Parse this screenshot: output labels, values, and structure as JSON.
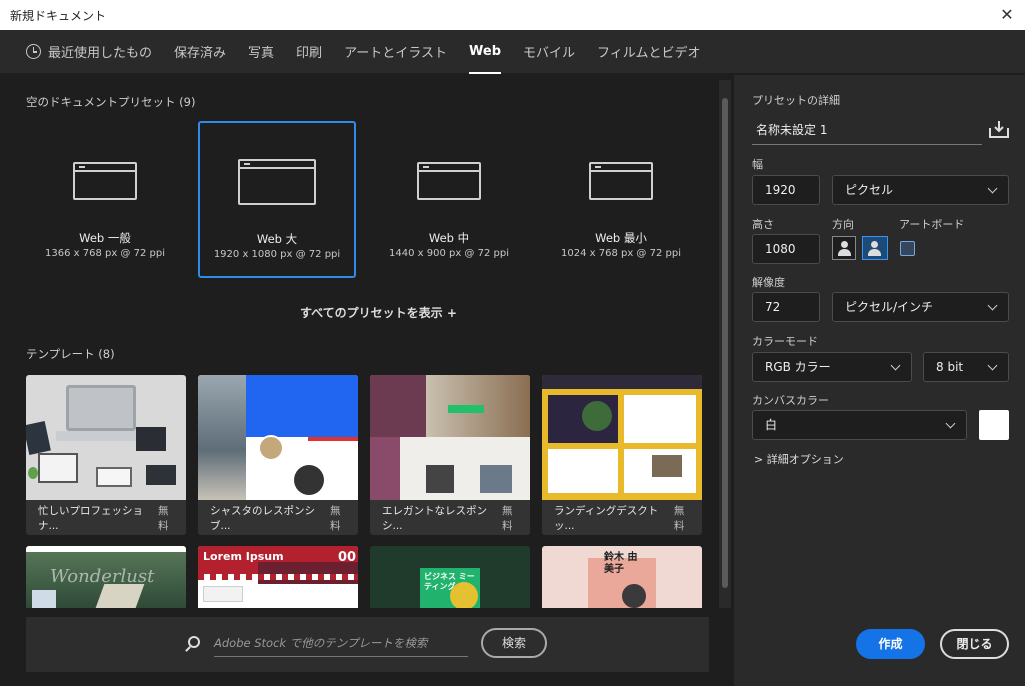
{
  "window": {
    "title": "新規ドキュメント"
  },
  "tabs": [
    {
      "label": "最近使用したもの"
    },
    {
      "label": "保存済み"
    },
    {
      "label": "写真"
    },
    {
      "label": "印刷"
    },
    {
      "label": "アートとイラスト"
    },
    {
      "label": "Web",
      "active": true
    },
    {
      "label": "モバイル"
    },
    {
      "label": "フィルムとビデオ"
    }
  ],
  "presets_section": {
    "label": "空のドキュメントプリセット (9)"
  },
  "presets": [
    {
      "name": "Web 一般",
      "size": "1366 x 768 px @ 72 ppi"
    },
    {
      "name": "Web 大",
      "size": "1920 x 1080 px @ 72 ppi",
      "selected": true
    },
    {
      "name": "Web 中",
      "size": "1440 x 900 px @ 72 ppi"
    },
    {
      "name": "Web 最小",
      "size": "1024 x 768 px @ 72 ppi"
    }
  ],
  "show_all_presets": "すべてのプリセットを表示 +",
  "templates_section": {
    "label": "テンプレート (8)"
  },
  "templates": [
    {
      "name": "忙しいプロフェッショナ...",
      "price": "無料"
    },
    {
      "name": "シャスタのレスポンシブ...",
      "price": "無料"
    },
    {
      "name": "エレガントなレスポンシ...",
      "price": "無料"
    },
    {
      "name": "ランディングデスクトッ...",
      "price": "無料"
    }
  ],
  "templates_row2": {
    "t1_text": "Wonderlust",
    "t2_title": "Lorem Ipsum",
    "t2_num": "00",
    "t3_text": "ビジネス ミーティング",
    "t4_text": "鈴木 由美子"
  },
  "stock_search": {
    "placeholder": "Adobe Stock で他のテンプレートを検索",
    "button": "検索"
  },
  "details": {
    "section_label": "プリセットの詳細",
    "doc_name": "名称未設定 1",
    "width_label": "幅",
    "width_value": "1920",
    "width_unit": "ピクセル",
    "height_label": "高さ",
    "height_value": "1080",
    "orientation_label": "方向",
    "artboard_label": "アートボード",
    "resolution_label": "解像度",
    "resolution_value": "72",
    "resolution_unit": "ピクセル/インチ",
    "color_mode_label": "カラーモード",
    "color_mode_value": "RGB カラー",
    "bit_depth_value": "8 bit",
    "canvas_color_label": "カンバスカラー",
    "canvas_color_value": "白",
    "canvas_color_hex": "#ffffff",
    "advanced_label": "> 詳細オプション"
  },
  "actions": {
    "create": "作成",
    "close": "閉じる"
  },
  "colors": {
    "accent": "#1473e6",
    "selection": "#2f8ce7"
  }
}
